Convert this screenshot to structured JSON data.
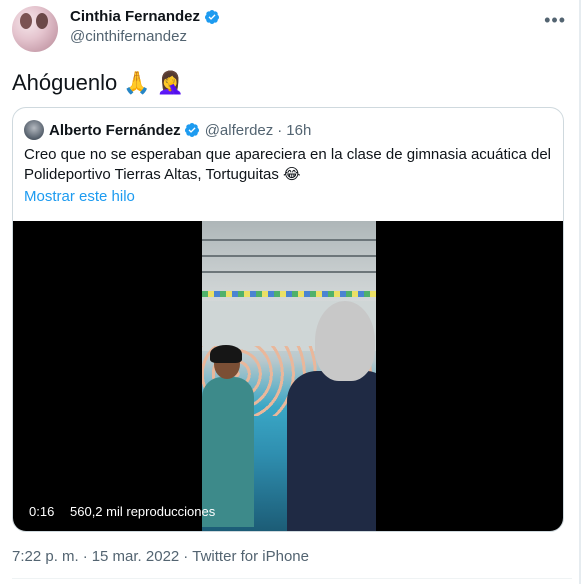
{
  "author": {
    "display_name": "Cinthia Fernandez",
    "handle": "@cinthifernandez",
    "verified": true,
    "avatar_icon": "profile-photo"
  },
  "more_icon": "more-horizontal-icon",
  "more_glyph": "•••",
  "tweet": {
    "text": "Ahóguenlo",
    "emojis": [
      "🙏",
      "🤦‍♀️"
    ]
  },
  "quoted": {
    "display_name": "Alberto Fernández",
    "handle": "@alferdez",
    "separator": "·",
    "time": "16h",
    "verified": true,
    "text": "Creo que no se esperaban que apareciera en la clase de gimnasia acuática del Polideportivo Tierras Altas, Tortuguitas 😂",
    "show_thread": "Mostrar este hilo",
    "video": {
      "duration": "0:16",
      "views": "560,2 mil reproducciones"
    }
  },
  "footer": {
    "time": "7:22 p. m.",
    "separator": "·",
    "date": "15 mar. 2022",
    "separator2": "·",
    "source": "Twitter for iPhone"
  },
  "colors": {
    "link": "#1d9bf0",
    "secondary_text": "#536471",
    "verified_badge": "#1d9bf0"
  }
}
